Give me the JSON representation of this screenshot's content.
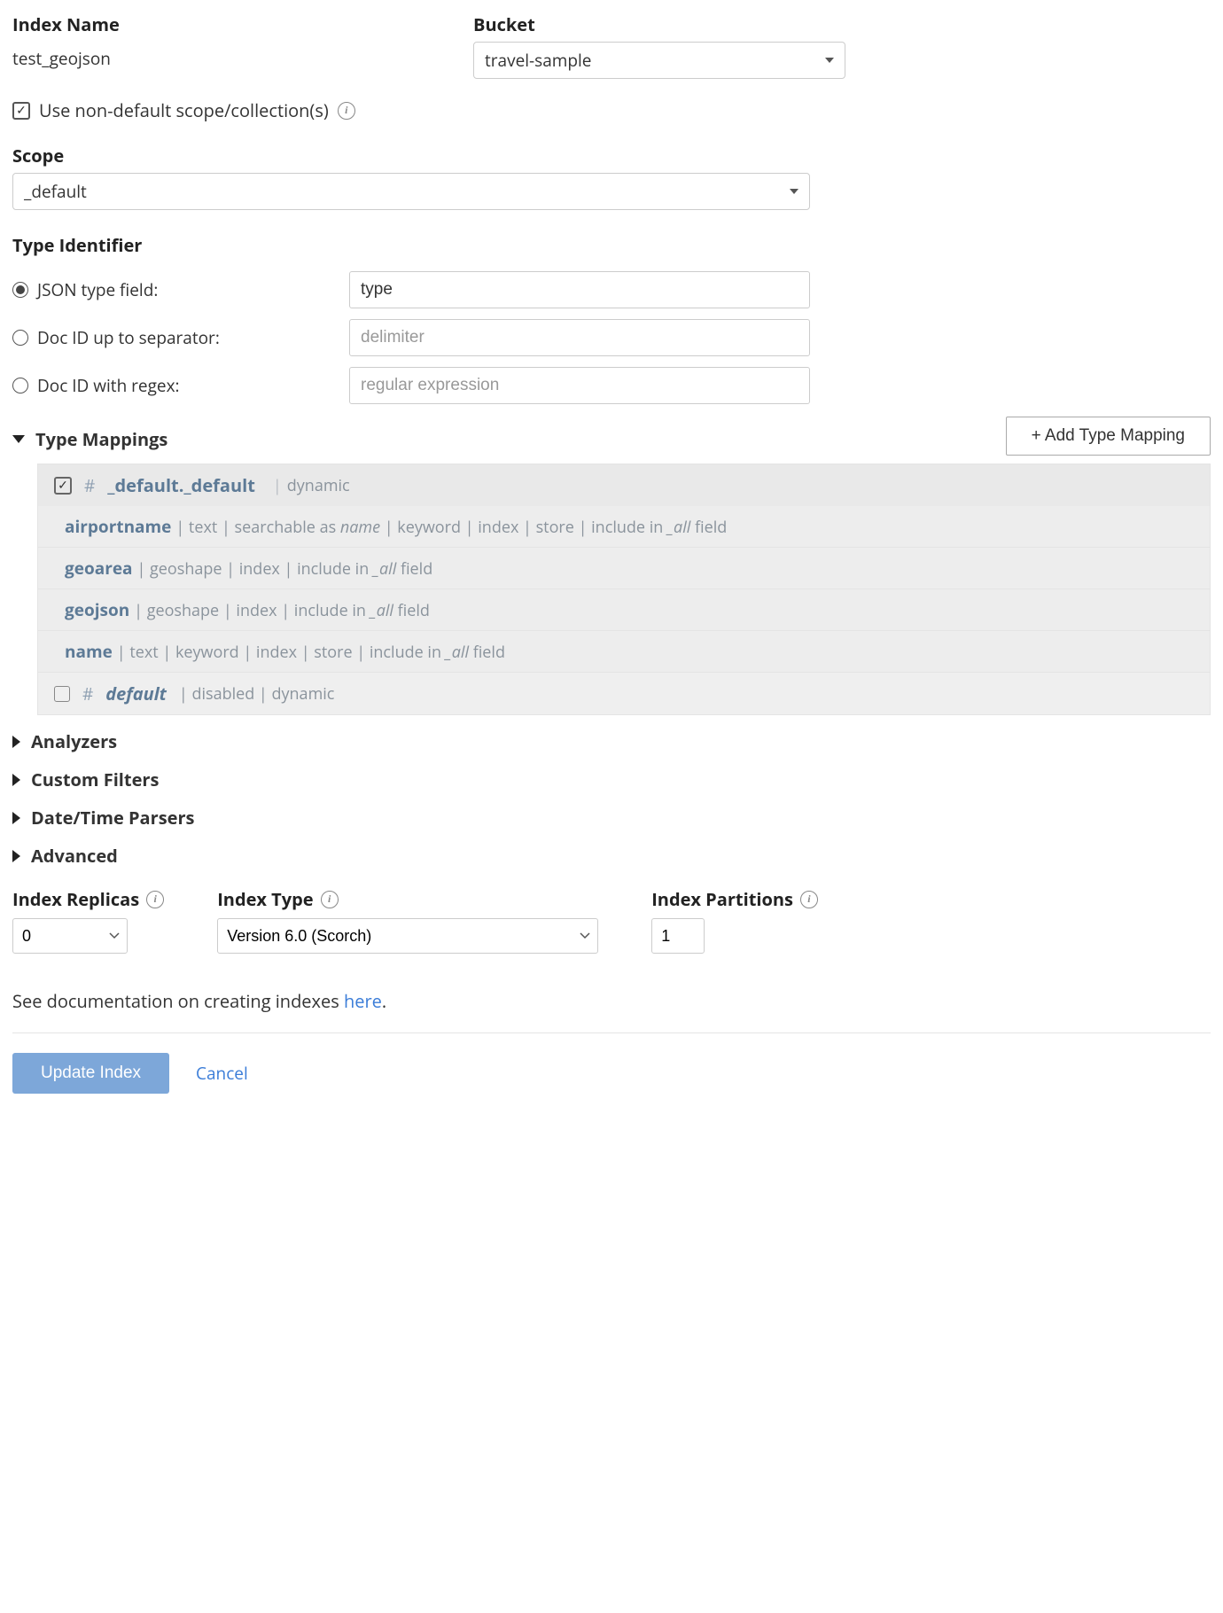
{
  "header": {
    "indexNameLabel": "Index Name",
    "indexNameValue": "test_geojson",
    "bucketLabel": "Bucket",
    "bucketValue": "travel-sample"
  },
  "nonDefault": {
    "label": "Use non-default scope/collection(s)"
  },
  "scope": {
    "label": "Scope",
    "value": "_default"
  },
  "typeIdentifier": {
    "heading": "Type Identifier",
    "options": {
      "json": {
        "label": "JSON type field:",
        "value": "type"
      },
      "sep": {
        "label": "Doc ID up to separator:",
        "placeholder": "delimiter"
      },
      "regex": {
        "label": "Doc ID with regex:",
        "placeholder": "regular expression"
      }
    }
  },
  "typeMappings": {
    "heading": "Type Mappings",
    "addBtn": "+ Add Type Mapping",
    "main": {
      "name": "_default._default",
      "meta": "dynamic",
      "fields": [
        {
          "name": "airportname",
          "meta": "| text | searchable as <i>name</i> | keyword | index | store | include in <i>_all</i> field"
        },
        {
          "name": "geoarea",
          "meta": "| geoshape | index | include in <i>_all</i> field"
        },
        {
          "name": "geojson",
          "meta": "| geoshape | index | include in <i>_all</i> field"
        },
        {
          "name": "name",
          "meta": "| text | keyword | index | store | include in <i>_all</i> field"
        }
      ]
    },
    "secondary": {
      "name": "default",
      "meta": "| disabled | dynamic"
    }
  },
  "collapsed": {
    "analyzers": "Analyzers",
    "customFilters": "Custom Filters",
    "dateParsers": "Date/Time Parsers",
    "advanced": "Advanced"
  },
  "bottom": {
    "replicasLabel": "Index Replicas",
    "replicasValue": "0",
    "typeLabel": "Index Type",
    "typeValue": "Version 6.0 (Scorch)",
    "partitionsLabel": "Index Partitions",
    "partitionsValue": "1"
  },
  "docLine": {
    "prefix": "See documentation on creating indexes ",
    "linkText": "here",
    "suffix": "."
  },
  "actions": {
    "update": "Update Index",
    "cancel": "Cancel"
  }
}
